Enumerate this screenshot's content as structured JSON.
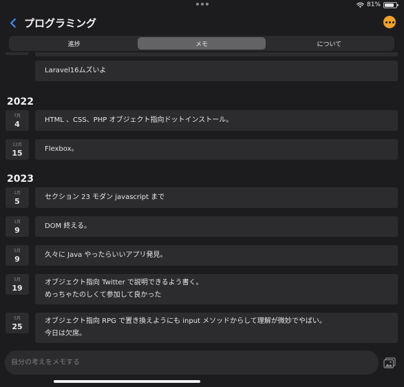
{
  "status": {
    "battery_text": "81%",
    "battery_level": 0.81
  },
  "nav": {
    "title": "プログラミング"
  },
  "segments": [
    {
      "label": "進捗",
      "active": false
    },
    {
      "label": "メモ",
      "active": true
    },
    {
      "label": "について",
      "active": false
    }
  ],
  "memos": {
    "top_entry": {
      "text": "Laravel16ムズいよ"
    },
    "years": [
      {
        "year": "2022",
        "entries": [
          {
            "month": "7月",
            "day": "4",
            "lines": [
              "HTML 、CSS、PHP オブジェクト指向ドットインストール。"
            ]
          },
          {
            "month": "12月",
            "day": "15",
            "lines": [
              "Flexbox。"
            ]
          }
        ]
      },
      {
        "year": "2023",
        "entries": [
          {
            "month": "1月",
            "day": "5",
            "lines": [
              "セクション 23 モダン javascript まで"
            ]
          },
          {
            "month": "1月",
            "day": "9",
            "lines": [
              "DOM 終える。"
            ]
          },
          {
            "month": "5月",
            "day": "9",
            "lines": [
              "久々に Java やったらいいアプリ発見。"
            ]
          },
          {
            "month": "5月",
            "day": "19",
            "lines": [
              "オブジェクト指向 Twitter で説明できるよう書く。",
              "めっちゃたのしくて参加して良かった"
            ]
          },
          {
            "month": "5月",
            "day": "25",
            "lines": [
              "オブジェクト指向 RPG で置き換えようにも input メソッドからして理解が微妙でやばい。",
              "今日は欠席。"
            ]
          }
        ]
      }
    ]
  },
  "input": {
    "placeholder": "自分の考えをメモする",
    "value": ""
  },
  "icons": {
    "back": "chevron-left-icon",
    "more": "ellipsis-circle-icon",
    "image": "photo-icon",
    "wifi": "wifi-icon",
    "battery": "battery-icon"
  },
  "colors": {
    "background": "#1c1c1e",
    "card": "#2c2c2e",
    "accent_blue": "#3a8ef6",
    "accent_orange": "#f0a02a",
    "segment_active": "#636366"
  }
}
